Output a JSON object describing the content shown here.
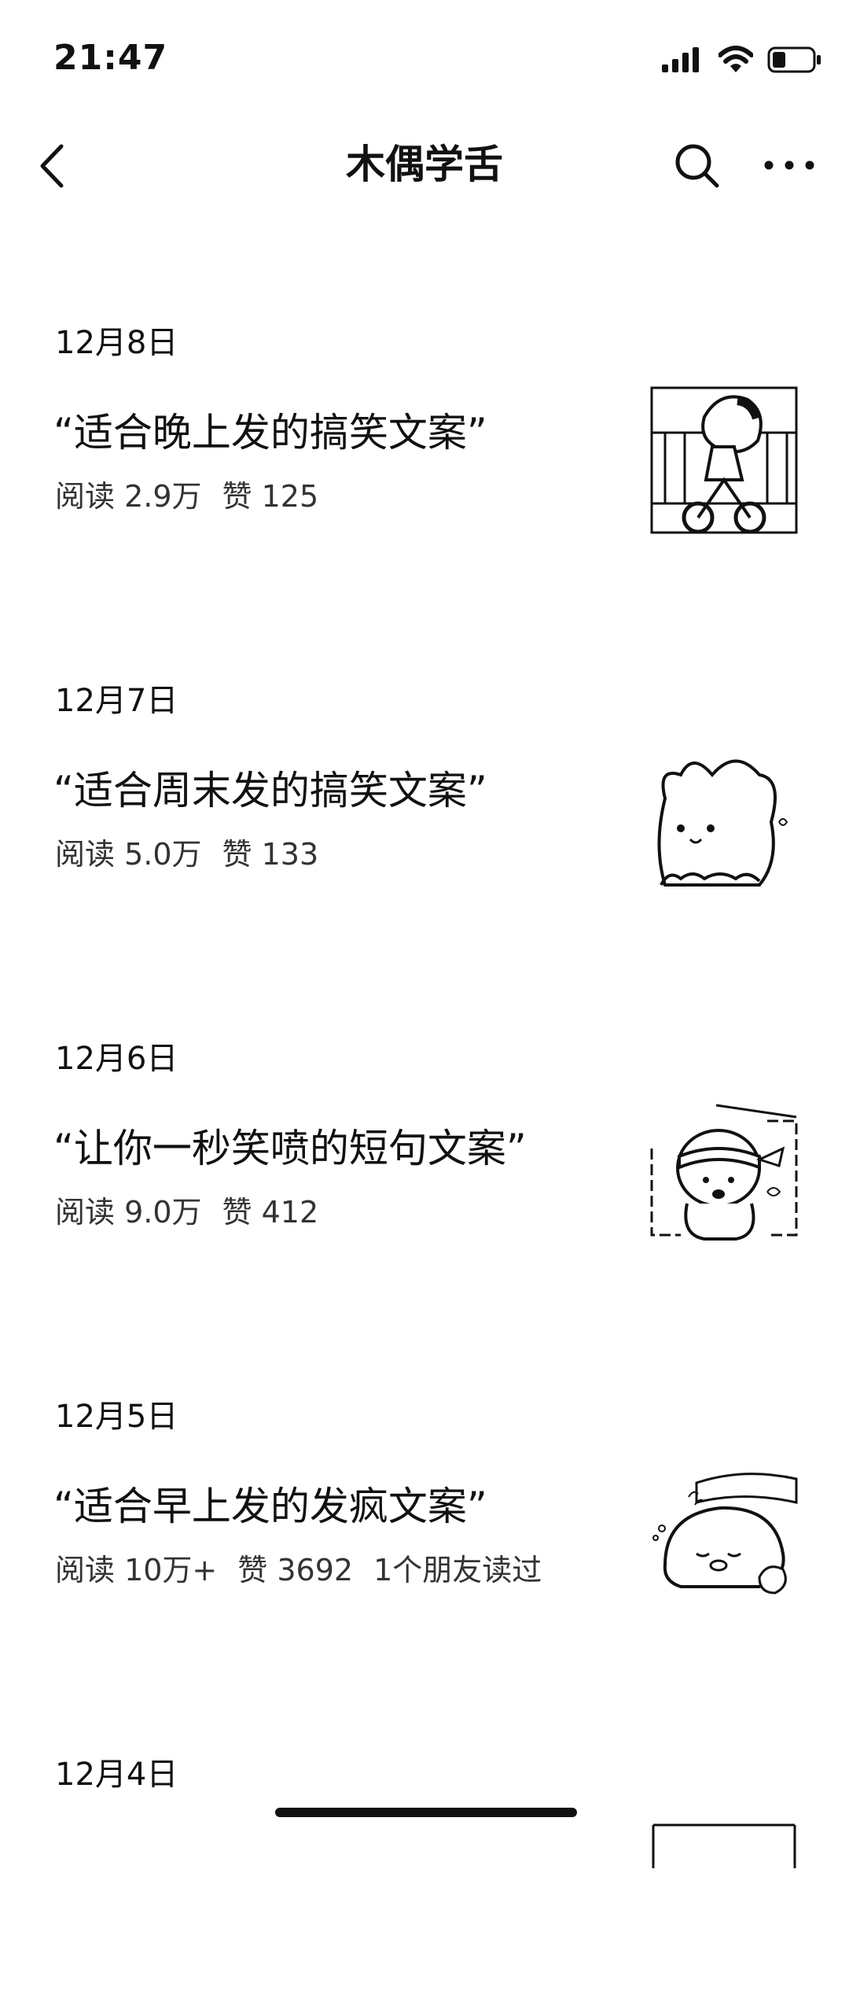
{
  "status_bar": {
    "time": "21:47"
  },
  "nav": {
    "title": "木偶学舌",
    "icons": [
      "back-icon",
      "search-icon",
      "more-icon"
    ]
  },
  "articles": [
    {
      "date": "12月8日",
      "title": "“适合晚上发的搞笑文案”",
      "reads": "阅读 2.9万",
      "likes": "赞 125",
      "friends": "",
      "thumb": "boy-on-tricycle-icon"
    },
    {
      "date": "12月7日",
      "title": "“适合周末发的搞笑文案”",
      "reads": "阅读 5.0万",
      "likes": "赞 133",
      "friends": "",
      "thumb": "bunny-icon"
    },
    {
      "date": "12月6日",
      "title": "“让你一秒笑喷的短句文案”",
      "reads": "阅读 9.0万",
      "likes": "赞 412",
      "friends": "",
      "thumb": "headband-bear-icon"
    },
    {
      "date": "12月5日",
      "title": "“适合早上发的发疯文案”",
      "reads": "阅读 10万+",
      "likes": "赞 3692",
      "friends": "1个朋友读过",
      "thumb": "sleeping-penguin-icon"
    },
    {
      "date": "12月4日",
      "title": "",
      "reads": "",
      "likes": "",
      "friends": "",
      "thumb": "partial-thumbnail"
    }
  ]
}
